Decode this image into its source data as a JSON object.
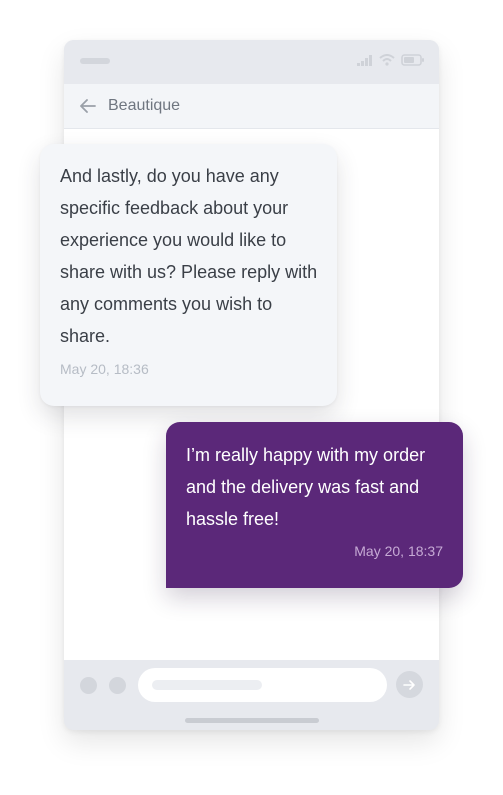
{
  "app": {
    "title": "Beautique"
  },
  "icons": {
    "back": "arrow-left-icon",
    "signal": "signal-icon",
    "wifi": "wifi-icon",
    "battery": "battery-icon",
    "send": "arrow-right-icon"
  },
  "colors": {
    "outgoing_bubble": "#5b2879",
    "incoming_bubble": "#f4f6f9",
    "frame": "#e7e9ee"
  },
  "messages": [
    {
      "direction": "incoming",
      "text": "And lastly, do you have any specific feedback about your experience you would like to share with us? Please reply with any comments you wish to share.",
      "time": "May 20, 18:36"
    },
    {
      "direction": "outgoing",
      "text": "I’m really happy with my order and the delivery was fast and hassle free!",
      "time": "May 20, 18:37"
    }
  ]
}
